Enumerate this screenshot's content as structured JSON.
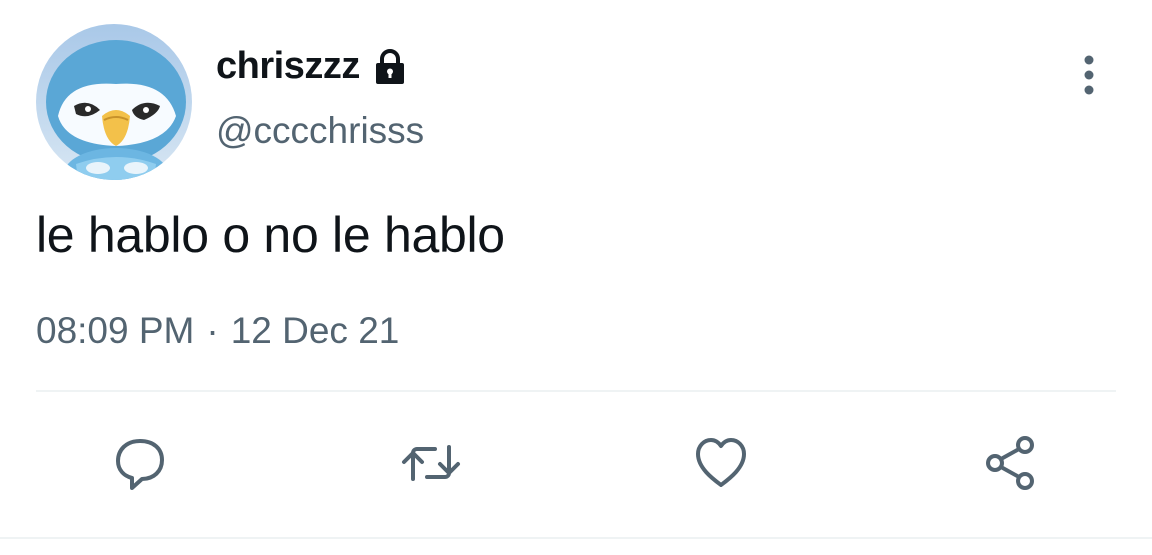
{
  "author": {
    "display_name": "chriszzz",
    "handle": "@cccchrisss",
    "protected_icon": "lock-icon",
    "avatar": "penguin-avatar"
  },
  "tweet": {
    "text": "le hablo o no le hablo",
    "time": "08:09 PM",
    "separator": "·",
    "date": "12 Dec 21"
  },
  "actions": [
    {
      "name": "reply",
      "icon": "speech-bubble-icon"
    },
    {
      "name": "retweet",
      "icon": "retweet-arrows-icon"
    },
    {
      "name": "like",
      "icon": "heart-icon"
    },
    {
      "name": "share",
      "icon": "share-nodes-icon"
    }
  ],
  "menu_icon": "more-vertical-icon",
  "colors": {
    "primary_text": "#0f1419",
    "secondary_text": "#536471",
    "divider": "#eff3f4"
  }
}
